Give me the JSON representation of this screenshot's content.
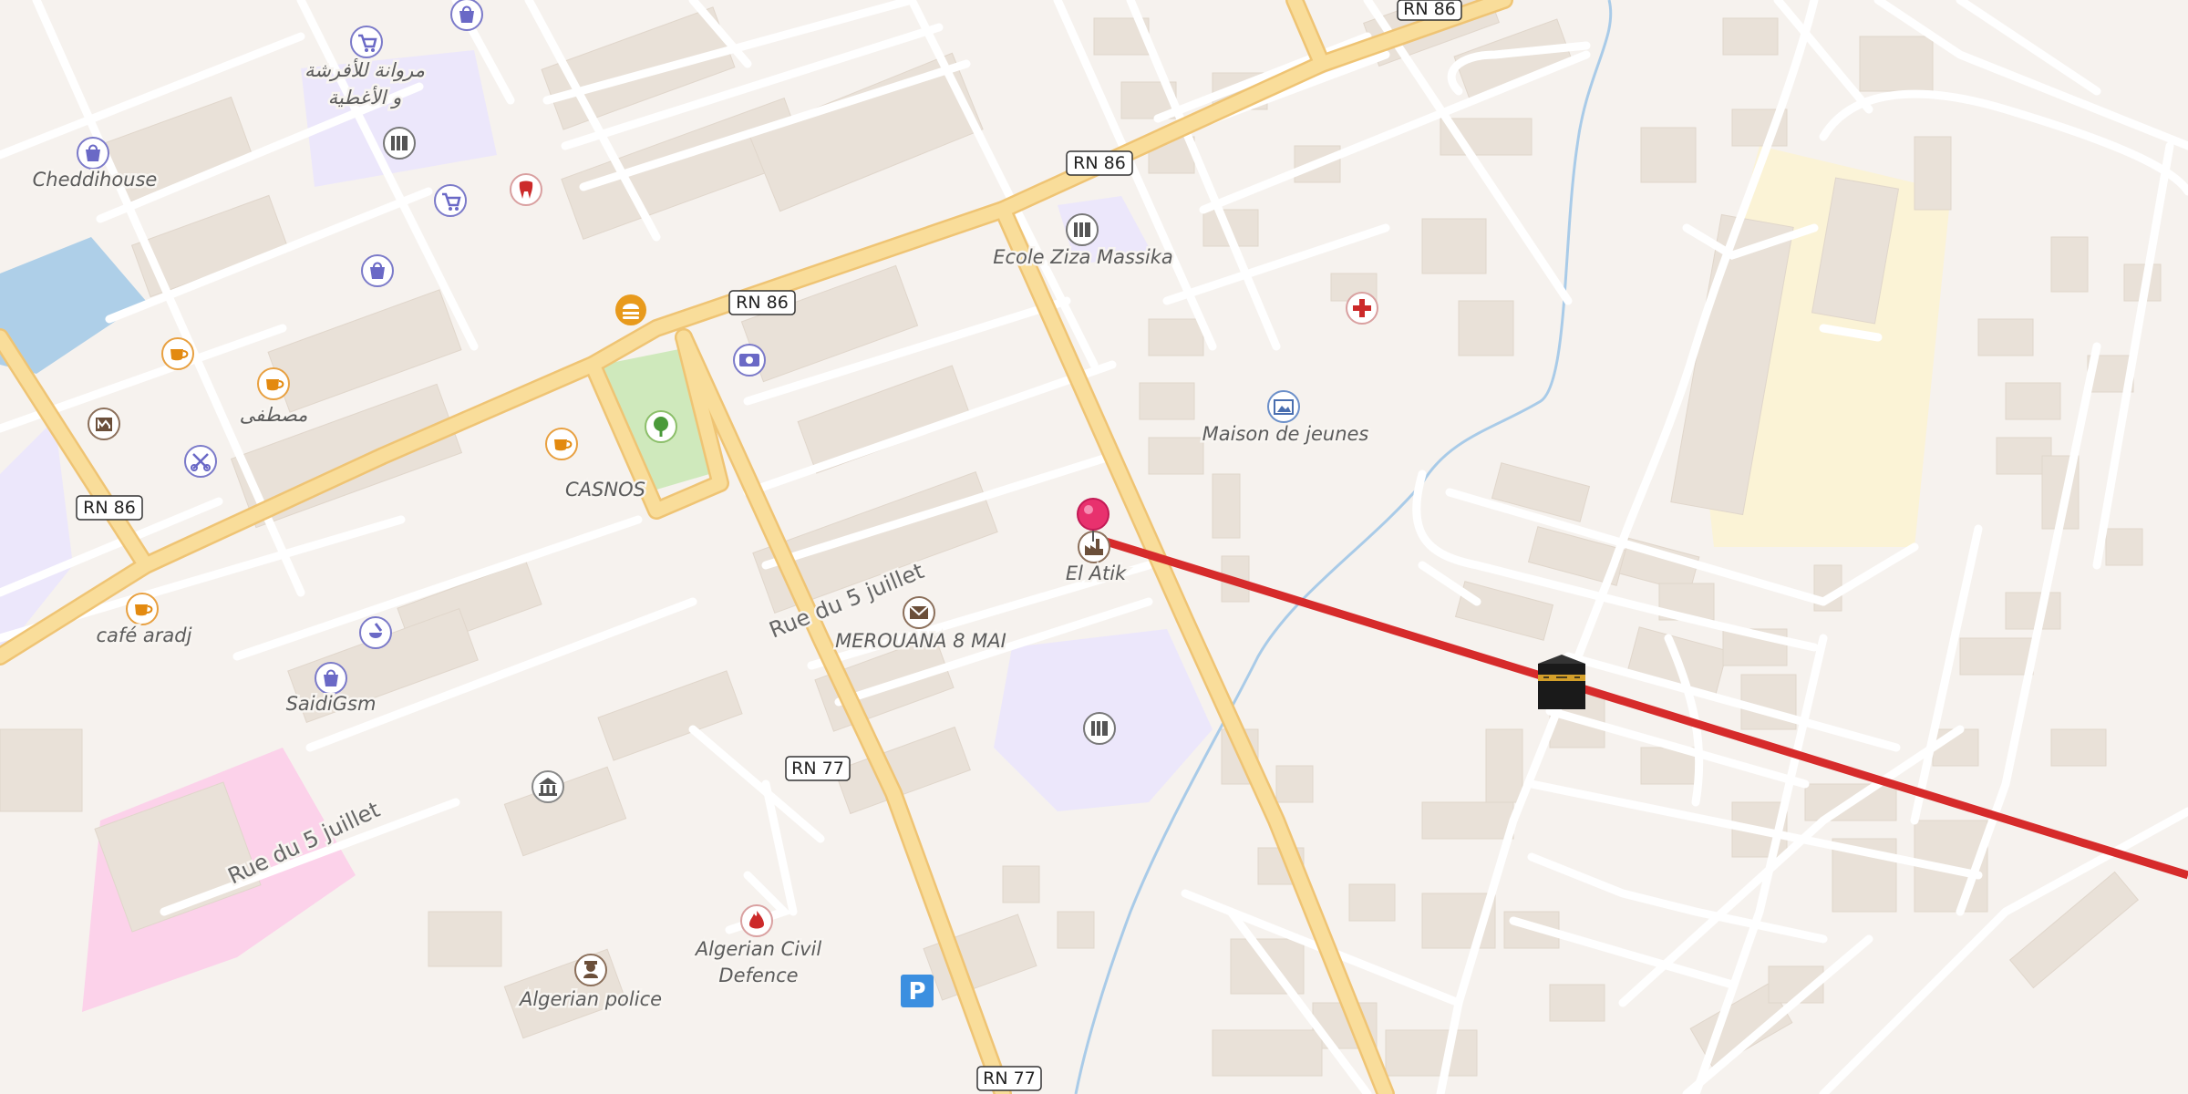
{
  "map": {
    "colors": {
      "background": "#f6f2ee",
      "building": "#e9e1d8",
      "primary_road": "#f7d88f",
      "minor_road": "#ffffff",
      "water": "#aecfe8",
      "park": "#cfe9bc",
      "school_area": "#ece7fb",
      "pink_area": "#fcd2ea",
      "yellow_area": "#fbf3d6",
      "route_line": "#d62b2b",
      "pin": "#e8316e"
    },
    "road_shields": [
      "RN 86",
      "RN 86",
      "RN 86",
      "RN 86",
      "RN 77",
      "RN 77"
    ],
    "street_names": [
      "Rue du 5 juillet",
      "Rue du 5 juillet"
    ],
    "places": [
      {
        "label": "Cheddihouse",
        "icon": "shopping-bag-icon"
      },
      {
        "label": "مروانة للأفرشة",
        "icon": "shopping-cart-icon"
      },
      {
        "label": "و الأغطية",
        "icon": ""
      },
      {
        "label": "Ecole Ziza Massika",
        "icon": "school-icon"
      },
      {
        "label": "Maison de jeunes",
        "icon": "gallery-icon"
      },
      {
        "label": "CASNOS",
        "icon": "cafe-icon"
      },
      {
        "label": "مصطفى",
        "icon": "cafe-icon"
      },
      {
        "label": "café aradj",
        "icon": "cafe-icon"
      },
      {
        "label": "SaidiGsm",
        "icon": "shopping-bag-icon"
      },
      {
        "label": "El Atik",
        "icon": "factory-icon"
      },
      {
        "label": "MEROUANA 8 MAI",
        "icon": "post-office-icon"
      },
      {
        "label": "Algerian Civil",
        "icon": "fire-station-icon"
      },
      {
        "label": "Defence",
        "icon": ""
      },
      {
        "label": "Algerian police",
        "icon": "police-icon"
      }
    ],
    "icons": [
      "shopping-cart-icon",
      "shopping-bag-icon",
      "dentist-icon",
      "school-icon",
      "fast-food-icon",
      "money-icon",
      "tree-icon",
      "pharmacy-icon",
      "museum-icon",
      "hairdresser-icon",
      "bank-icon",
      "parking-icon",
      "hospital-icon",
      "mosque-icon",
      "location-pin-icon"
    ]
  }
}
